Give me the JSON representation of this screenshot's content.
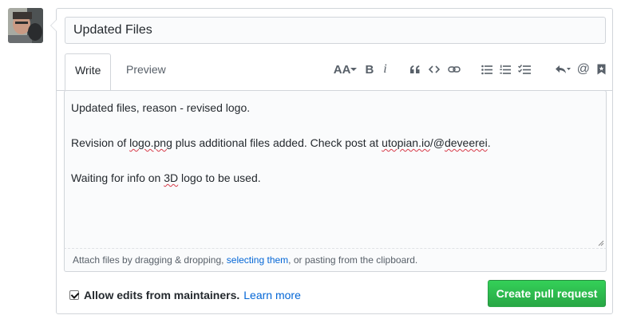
{
  "title_input": {
    "value": "Updated Files"
  },
  "tabs": {
    "write": "Write",
    "preview": "Preview"
  },
  "toolbar": {
    "header_label": "AA",
    "bold_label": "B",
    "italic_label": "i",
    "mention_label": "@"
  },
  "editor": {
    "line1": "Updated files, reason - revised logo.",
    "line2": {
      "a": "Revision of ",
      "b": "logo.png",
      "c": " plus additional files added. Check post at ",
      "d": "utopian.io",
      "e": "/@",
      "f": "deveerei",
      "g": "."
    },
    "line3": {
      "a": "Waiting for info on ",
      "b": "3D",
      "c": " logo to be used."
    }
  },
  "attach": {
    "before": "Attach files by dragging & dropping, ",
    "link": "selecting them",
    "after": ", or pasting from the clipboard."
  },
  "footer": {
    "allow_label": "Allow edits from maintainers.",
    "learn_more": "Learn more",
    "checkbox_checked": true
  },
  "create_button": "Create pull request",
  "colors": {
    "primary_button": "#28a745",
    "link": "#0366d6",
    "border": "#d1d5da"
  }
}
